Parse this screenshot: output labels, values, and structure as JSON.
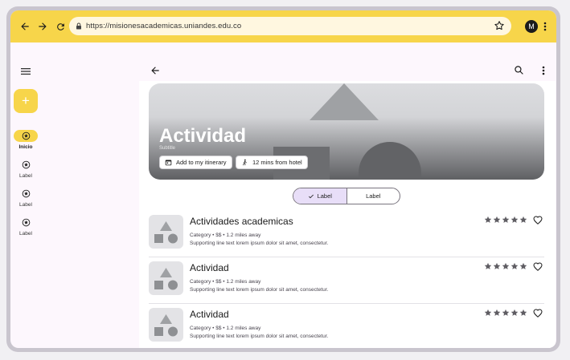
{
  "browser": {
    "url": "https://misionesacademicas.uniandes.edu.co",
    "avatar_initial": "M",
    "nav_icons": [
      "back-icon",
      "forward-icon",
      "reload-icon"
    ]
  },
  "rail": {
    "items": [
      {
        "label": "Inicio",
        "active": true
      },
      {
        "label": "Label",
        "active": false
      },
      {
        "label": "Label",
        "active": false
      },
      {
        "label": "Label",
        "active": false
      }
    ],
    "fab_symbol": "+"
  },
  "hero": {
    "title": "Actividad",
    "subtitle": "Subtitle",
    "chips": [
      {
        "label": "Add to my itinerary",
        "icon": "calendar-icon"
      },
      {
        "label": "12 mins from hotel",
        "icon": "walk-icon"
      }
    ]
  },
  "segmented": {
    "options": [
      {
        "label": "Label",
        "selected": true
      },
      {
        "label": "Label",
        "selected": false
      }
    ]
  },
  "list": [
    {
      "title": "Actividades academicas",
      "meta": "Category • $$ • 1.2 miles away",
      "support": "Supporting line text lorem ipsum dolor sit amet, consectetur.",
      "rating": 5
    },
    {
      "title": "Actividad",
      "meta": "Category • $$ • 1.2 miles away",
      "support": "Supporting line text lorem ipsum dolor sit amet, consectetur.",
      "rating": 5
    },
    {
      "title": "Actividad",
      "meta": "Category • $$ • 1.2 miles away",
      "support": "Supporting line text lorem ipsum dolor sit amet, consectetur.",
      "rating": 5
    }
  ],
  "colors": {
    "accent": "#f7d54a",
    "secondary_container": "#e8def8",
    "surface": "#fdf7fd"
  }
}
